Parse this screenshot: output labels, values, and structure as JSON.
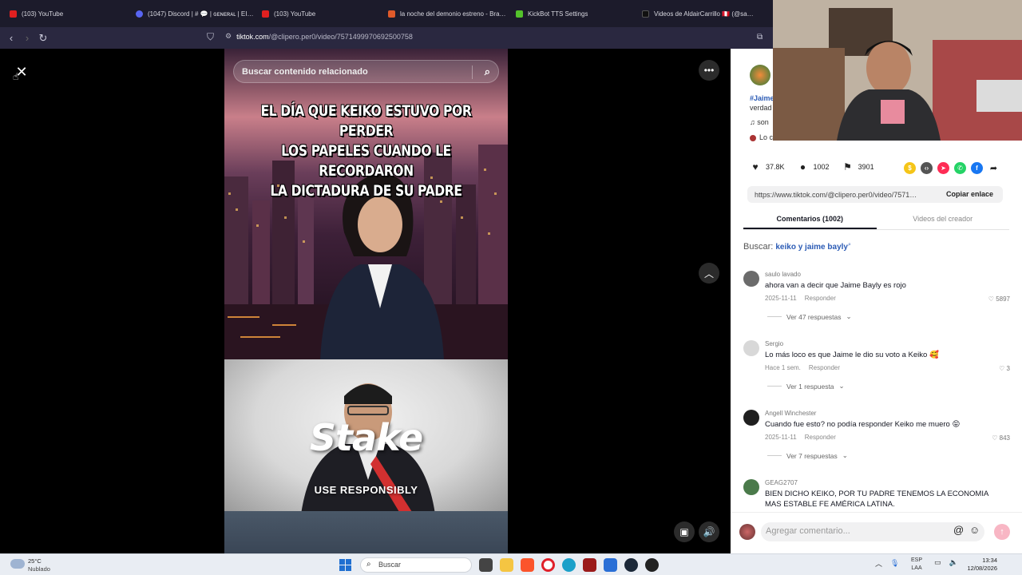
{
  "browser": {
    "tabs": [
      {
        "label": "(103) YouTube",
        "color": "#e02020"
      },
      {
        "label": "(1047) Discord | # 💬 | ɢᴇɴᴇʀᴀʟ | EISU…",
        "color": "#5865f2"
      },
      {
        "label": "(103) YouTube",
        "color": "#e02020"
      },
      {
        "label": "la noche del demonio estreno - Bra…",
        "color": "#e05a2a"
      },
      {
        "label": "KickBot TTS Settings",
        "color": "#53c22b"
      },
      {
        "label": "Videos de AldairCarrillo 🇵🇪 (@sa…",
        "color": "#111111"
      }
    ],
    "url_domain": "tiktok.com",
    "url_path": "/@clipero.per0/video/7571499970692500758"
  },
  "video": {
    "search_placeholder": "Buscar contenido relacionado",
    "caption_lines": [
      "EL DÍA QUE KEIKO ESTUVO POR PERDER",
      "LOS PAPELES CUANDO LE RECORDARON",
      "LA DICTADURA DE SU PADRE"
    ],
    "ad_brand": "Stake",
    "ad_tagline": "USE RESPONSIBLY"
  },
  "panel": {
    "desc_tag": "#Jaime",
    "desc_line2": "verdad",
    "sound_label": "♫  son",
    "effect_label": "Lo c",
    "stats": {
      "likes": "37.8K",
      "comments": "1002",
      "saves": "3901"
    },
    "link_text": "https://www.tiktok.com/@clipero.per0/video/7571…",
    "copy_label": "Copiar enlace",
    "tabs": [
      "Comentarios (1002)",
      "Videos del creador"
    ],
    "search_prefix": "Buscar:",
    "search_keyword": "keiko y jaime bayly",
    "comments": [
      {
        "user": "saulo lavado",
        "text": "ahora van a decir que Jaime Bayly es rojo",
        "date": "2025-11-11",
        "reply": "Responder",
        "likes": "5897",
        "replies": "Ver 47 respuestas",
        "avatar": "#6b6b6b"
      },
      {
        "user": "Sergio",
        "text": "Lo más loco es que Jaime le dio su voto a Keiko 🥰",
        "date": "Hace 1 sem.",
        "reply": "Responder",
        "likes": "3",
        "replies": "Ver 1 respuesta",
        "avatar": "#d8d8d8"
      },
      {
        "user": "Angell Winchester",
        "text": "Cuando fue esto? no podía responder Keiko me muero 😝",
        "date": "2025-11-11",
        "reply": "Responder",
        "likes": "843",
        "replies": "Ver 7 respuestas",
        "avatar": "#1f1f1f"
      },
      {
        "user": "GEAG2707",
        "text": "BIEN DICHO KEIKO, POR TU PADRE TENEMOS LA ECONOMIA MAS ESTABLE FE AMÉRICA LATINA.",
        "date": "",
        "reply": "",
        "likes": "",
        "replies": "",
        "avatar": "#4a7a4a"
      }
    ],
    "comment_placeholder": "Agregar comentario..."
  },
  "taskbar": {
    "temp": "25°C",
    "condition": "Nublado",
    "search": "Buscar",
    "lang1": "ESP",
    "lang2": "LAA",
    "time": "13:34",
    "date": "12/08/2026"
  },
  "colors": {
    "accent": "#fe2c55",
    "link": "#2b5bb5"
  }
}
